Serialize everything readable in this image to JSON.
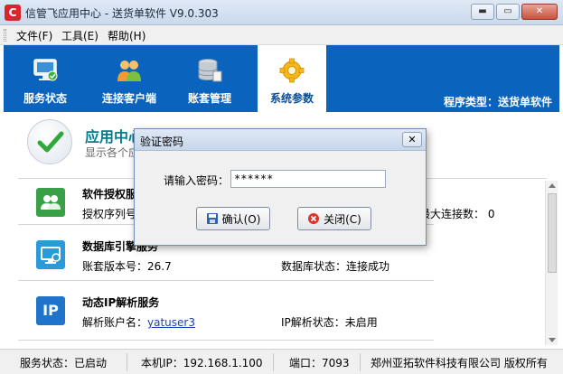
{
  "window": {
    "title": "信管飞应用中心 - 送货单软件 V9.0.303",
    "minimize_glyph": "▬",
    "maximize_glyph": "▭",
    "close_glyph": "✕",
    "app_icon_glyph": "C"
  },
  "menu": {
    "file": "文件(F)",
    "tools": "工具(E)",
    "help": "帮助(H)"
  },
  "nav": {
    "tabs": [
      {
        "label": "服务状态",
        "icon": "monitor-check-icon"
      },
      {
        "label": "连接客户端",
        "icon": "users-icon"
      },
      {
        "label": "账套管理",
        "icon": "database-icon"
      },
      {
        "label": "系统参数",
        "icon": "gear-icon"
      }
    ],
    "program_type": "程序类型：送货单软件",
    "active_color": "#0a64bd"
  },
  "header": {
    "title": "应用中心运行状态",
    "subtitle": "显示各个应用服务的状态"
  },
  "services": [
    {
      "title": "软件授权服务",
      "line1": "授权序列号：",
      "line2_label": "最大连接数：",
      "line2_value": "0",
      "icon": "users-icon"
    },
    {
      "title": "数据库引擎服务",
      "line1": "账套版本号：26.7",
      "line2": "数据库状态：连接成功",
      "icon": "monitor-icon"
    },
    {
      "title": "动态IP解析服务",
      "line1_label": "解析账户名：",
      "line1_link": "yatuser3",
      "line2": "IP解析状态：未启用",
      "icon": "ip-icon",
      "icon_text": "IP"
    }
  ],
  "statusbar": {
    "service_status": "服务状态：已启动",
    "local_ip": "本机IP：192.168.1.100",
    "port": "端口：7093",
    "copyright": "郑州亚拓软件科技有限公司 版权所有"
  },
  "dialog": {
    "title": "验证密码",
    "close_glyph": "✕",
    "password_label": "请输入密码：",
    "password_value": "******",
    "ok_label": "确认(O)",
    "close_label": "关闭(C)"
  }
}
